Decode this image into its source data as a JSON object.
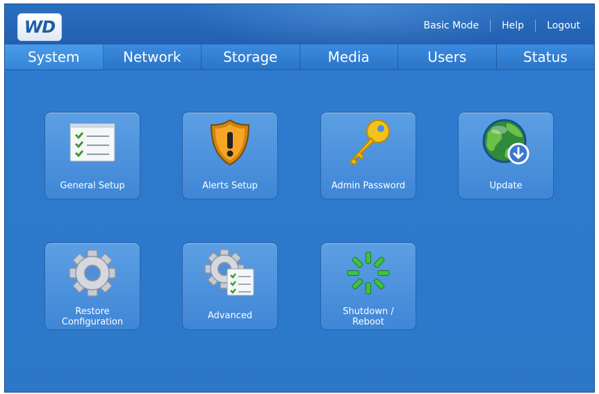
{
  "header": {
    "logo_text": "WD",
    "links": {
      "basic_mode": "Basic Mode",
      "help": "Help",
      "logout": "Logout"
    }
  },
  "tabs": [
    {
      "label": "System",
      "active": true
    },
    {
      "label": "Network",
      "active": false
    },
    {
      "label": "Storage",
      "active": false
    },
    {
      "label": "Media",
      "active": false
    },
    {
      "label": "Users",
      "active": false
    },
    {
      "label": "Status",
      "active": false
    }
  ],
  "tiles": {
    "general_setup": {
      "label": "General Setup",
      "icon": "checklist-icon"
    },
    "alerts_setup": {
      "label": "Alerts Setup",
      "icon": "warning-shield-icon"
    },
    "admin_password": {
      "label": "Admin Password",
      "icon": "key-icon"
    },
    "update": {
      "label": "Update",
      "icon": "globe-download-icon"
    },
    "restore_configuration": {
      "label_line1": "Restore",
      "label_line2": "Configuration",
      "icon": "gear-icon"
    },
    "advanced": {
      "label": "Advanced",
      "icon": "gear-checklist-icon"
    },
    "shutdown_reboot": {
      "label_line1": "Shutdown /",
      "label_line2": "Reboot",
      "icon": "power-spinner-icon"
    }
  }
}
